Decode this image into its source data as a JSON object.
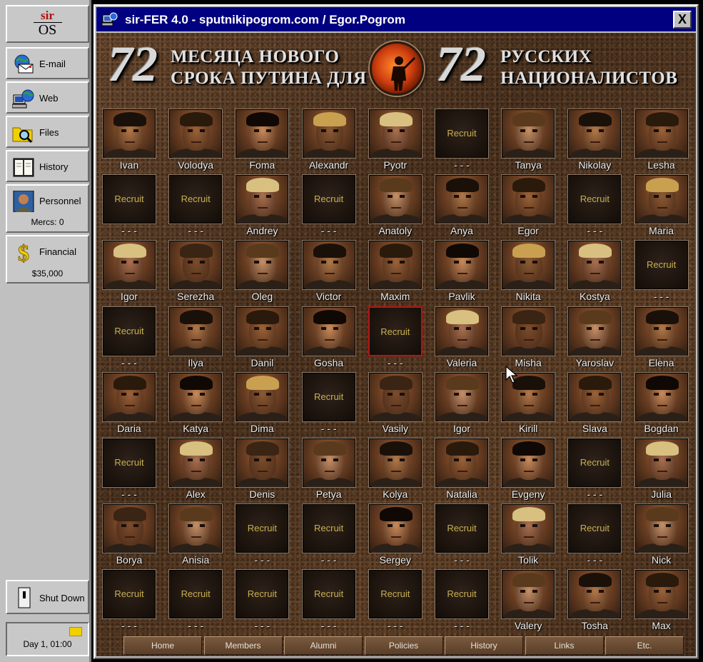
{
  "sidebar": {
    "logo": {
      "top": "sir",
      "bottom": "OS"
    },
    "email_label": "E-mail",
    "web_label": "Web",
    "files_label": "Files",
    "history_label": "History",
    "personnel_label": "Personnel",
    "mercs_label": "Mercs: 0",
    "financial_label": "Financial",
    "balance": "$35,000",
    "shutdown_label": "Shut Down",
    "day_time": "Day 1, 01:00"
  },
  "window": {
    "title": "sir-FER 4.0 - sputnikipogrom.com / Egor.Pogrom",
    "close_label": "X",
    "title_color": "#000080"
  },
  "banner": {
    "left_number": "72",
    "left_line1": "МЕСЯЦА НОВОГО",
    "left_line2": "СРОКА ПУТИНА ДЛЯ",
    "right_number": "72",
    "right_line1": "РУССКИХ",
    "right_line2": "НАЦИОНАЛИСТОВ"
  },
  "grid": {
    "recruit_label": "Recruit",
    "empty_name": "- - -",
    "rows": [
      [
        {
          "name": "Ivan",
          "state": "filled"
        },
        {
          "name": "Volodya",
          "state": "filled"
        },
        {
          "name": "Foma",
          "state": "filled"
        },
        {
          "name": "Alexandr",
          "state": "filled"
        },
        {
          "name": "Pyotr",
          "state": "filled"
        },
        {
          "name": "",
          "state": "empty"
        },
        {
          "name": "Tanya",
          "state": "filled"
        },
        {
          "name": "Nikolay",
          "state": "filled"
        },
        {
          "name": "Lesha",
          "state": "filled"
        }
      ],
      [
        {
          "name": "",
          "state": "empty"
        },
        {
          "name": "",
          "state": "empty"
        },
        {
          "name": "Andrey",
          "state": "filled"
        },
        {
          "name": "",
          "state": "empty"
        },
        {
          "name": "Anatoly",
          "state": "filled"
        },
        {
          "name": "Anya",
          "state": "filled"
        },
        {
          "name": "Egor",
          "state": "filled"
        },
        {
          "name": "",
          "state": "empty"
        },
        {
          "name": "Maria",
          "state": "filled"
        }
      ],
      [
        {
          "name": "Igor",
          "state": "filled"
        },
        {
          "name": "Serezha",
          "state": "filled"
        },
        {
          "name": "Oleg",
          "state": "filled"
        },
        {
          "name": "Victor",
          "state": "filled"
        },
        {
          "name": "Maxim",
          "state": "filled"
        },
        {
          "name": "Pavlik",
          "state": "filled"
        },
        {
          "name": "Nikita",
          "state": "filled"
        },
        {
          "name": "Kostya",
          "state": "filled"
        },
        {
          "name": "",
          "state": "empty"
        }
      ],
      [
        {
          "name": "",
          "state": "empty"
        },
        {
          "name": "Ilya",
          "state": "filled"
        },
        {
          "name": "Danil",
          "state": "filled"
        },
        {
          "name": "Gosha",
          "state": "filled"
        },
        {
          "name": "",
          "state": "empty",
          "selected": true
        },
        {
          "name": "Valeria",
          "state": "filled"
        },
        {
          "name": "Misha",
          "state": "filled"
        },
        {
          "name": "Yaroslav",
          "state": "filled"
        },
        {
          "name": "Elena",
          "state": "filled"
        }
      ],
      [
        {
          "name": "Daria",
          "state": "filled"
        },
        {
          "name": "Katya",
          "state": "filled"
        },
        {
          "name": "Dima",
          "state": "filled"
        },
        {
          "name": "",
          "state": "empty"
        },
        {
          "name": "Vasily",
          "state": "filled"
        },
        {
          "name": "Igor",
          "state": "filled"
        },
        {
          "name": "Kirill",
          "state": "filled"
        },
        {
          "name": "Slava",
          "state": "filled"
        },
        {
          "name": "Bogdan",
          "state": "filled"
        }
      ],
      [
        {
          "name": "",
          "state": "empty"
        },
        {
          "name": "Alex",
          "state": "filled"
        },
        {
          "name": "Denis",
          "state": "filled"
        },
        {
          "name": "Petya",
          "state": "filled"
        },
        {
          "name": "Kolya",
          "state": "filled"
        },
        {
          "name": "Natalia",
          "state": "filled"
        },
        {
          "name": "Evgeny",
          "state": "filled"
        },
        {
          "name": "",
          "state": "empty"
        },
        {
          "name": "Julia",
          "state": "filled"
        }
      ],
      [
        {
          "name": "Borya",
          "state": "filled"
        },
        {
          "name": "Anisia",
          "state": "filled"
        },
        {
          "name": "",
          "state": "empty"
        },
        {
          "name": "",
          "state": "empty"
        },
        {
          "name": "Sergey",
          "state": "filled"
        },
        {
          "name": "",
          "state": "empty"
        },
        {
          "name": "Tolik",
          "state": "filled"
        },
        {
          "name": "",
          "state": "empty"
        },
        {
          "name": "Nick",
          "state": "filled"
        }
      ],
      [
        {
          "name": "",
          "state": "empty"
        },
        {
          "name": "",
          "state": "empty"
        },
        {
          "name": "",
          "state": "empty"
        },
        {
          "name": "",
          "state": "empty"
        },
        {
          "name": "",
          "state": "empty"
        },
        {
          "name": "",
          "state": "empty"
        },
        {
          "name": "Valery",
          "state": "filled"
        },
        {
          "name": "Tosha",
          "state": "filled"
        },
        {
          "name": "Max",
          "state": "filled"
        }
      ]
    ]
  },
  "nav": [
    "Home",
    "Members",
    "Alumni",
    "Policies",
    "History",
    "Links",
    "Etc."
  ],
  "icons": {
    "email": "email-icon",
    "web": "web-icon",
    "files": "files-icon",
    "history": "history-book-icon",
    "personnel": "personnel-portrait-icon",
    "financial": "dollar-icon",
    "shutdown": "power-switch-icon",
    "folder": "folder-icon",
    "emblem": "soldier-emblem-icon",
    "cursor": "mouse-cursor-icon"
  }
}
